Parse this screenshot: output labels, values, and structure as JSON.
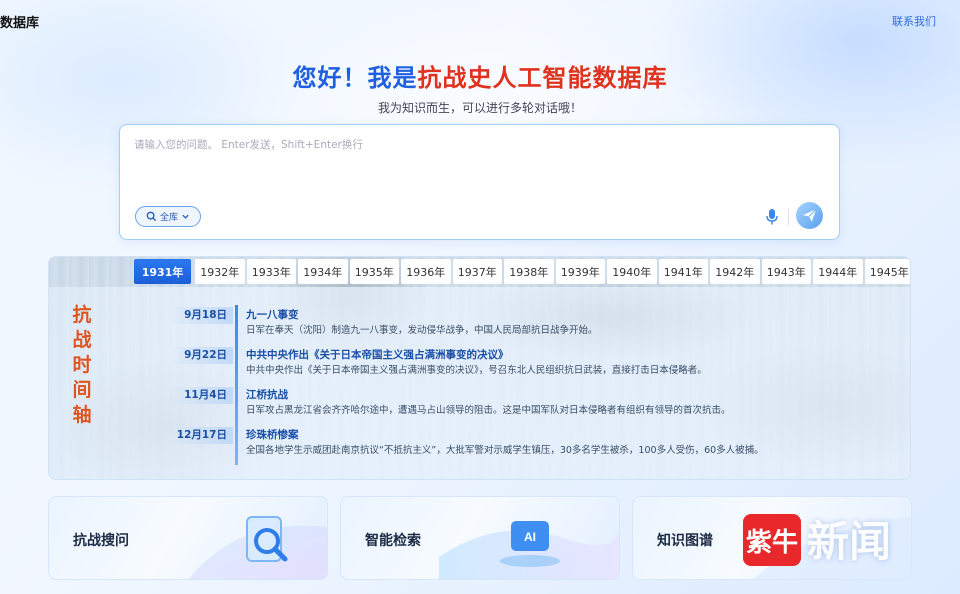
{
  "header": {
    "app_title": "数据库",
    "contact_label": "联系我们"
  },
  "hero": {
    "greeting": "您好！我是",
    "brand": "抗战史人工智能数据库",
    "subtitle": "我为知识而生，可以进行多轮对话哦！"
  },
  "ask": {
    "placeholder": "请输入您的问题。 Enter发送，Shift+Enter换行",
    "value": "",
    "scope_label": "全库",
    "mic_icon": "microphone-icon",
    "send_icon": "paper-plane-icon"
  },
  "timeline": {
    "title_chars": [
      "抗",
      "战",
      "时",
      "间",
      "轴"
    ],
    "years": [
      "1931年",
      "1932年",
      "1933年",
      "1934年",
      "1935年",
      "1936年",
      "1937年",
      "1938年",
      "1939年",
      "1940年",
      "1941年",
      "1942年",
      "1943年",
      "1944年",
      "1945年"
    ],
    "active_year": "1931年",
    "events": [
      {
        "date": "9月18日",
        "title": "九一八事变",
        "desc": "日军在奉天（沈阳）制造九一八事变，发动侵华战争，中国人民局部抗日战争开始。"
      },
      {
        "date": "9月22日",
        "title": "中共中央作出《关于日本帝国主义强占满洲事变的决议》",
        "desc": "中共中央作出《关于日本帝国主义强占满洲事变的决议》，号召东北人民组织抗日武装，直接打击日本侵略者。"
      },
      {
        "date": "11月4日",
        "title": "江桥抗战",
        "desc": "日军攻占黑龙江省会齐齐哈尔途中，遭遇马占山领导的阻击。这是中国军队对日本侵略者有组织有领导的首次抗击。"
      },
      {
        "date": "12月17日",
        "title": "珍珠桥惨案",
        "desc": "全国各地学生示威团赴南京抗议“不抵抗主义”，大批军警对示威学生镇压，30多名学生被杀，100多人受伤，60多人被捕。"
      }
    ]
  },
  "cards": [
    {
      "label": "抗战搜问",
      "icon": "search-magnifier-icon"
    },
    {
      "label": "智能检索",
      "icon": "ai-chip-icon"
    },
    {
      "label": "知识图谱",
      "icon": "knowledge-graph-icon"
    }
  ],
  "watermark": {
    "logo_text": "紫牛",
    "text": "新闻"
  },
  "colors": {
    "accent": "#1f5fe0",
    "brand_red": "#e0331f",
    "timeline_title": "#e0551f"
  }
}
